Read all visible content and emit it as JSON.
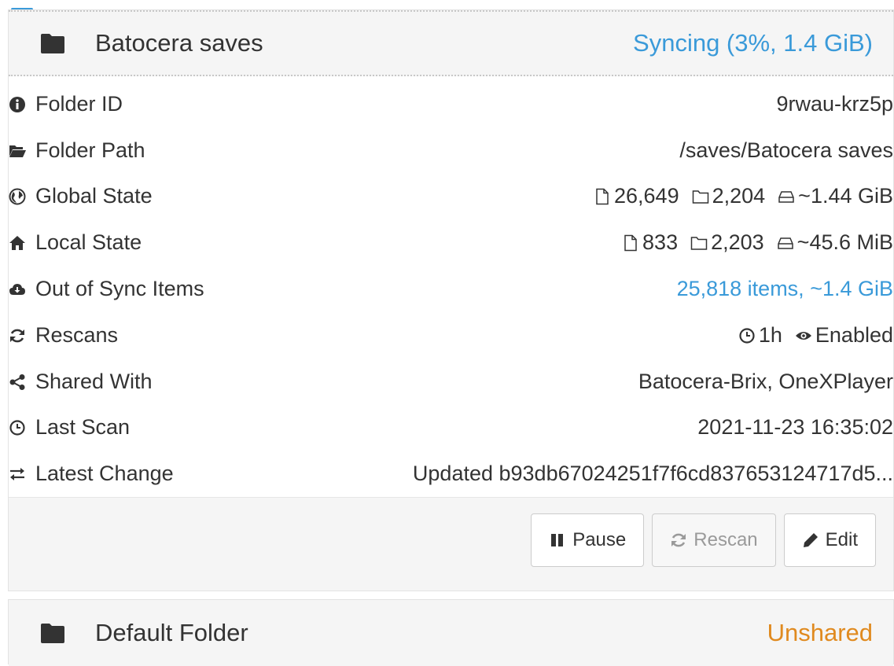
{
  "folder1": {
    "title": "Batocera saves",
    "status": "Syncing (3%, 1.4 GiB)",
    "sync_progress_percent": 3,
    "status_color": "#3a9ad9",
    "rows": {
      "folder_id": {
        "label": "Folder ID",
        "value": "9rwau-krz5p",
        "icon": "info-circle-icon"
      },
      "folder_path": {
        "label": "Folder Path",
        "value": "/saves/Batocera saves",
        "icon": "folder-open-icon"
      },
      "global_state": {
        "label": "Global State",
        "files": "26,649",
        "dirs": "2,204",
        "size": "~1.44 GiB",
        "icon": "globe-icon"
      },
      "local_state": {
        "label": "Local State",
        "files": "833",
        "dirs": "2,203",
        "size": "~45.6 MiB",
        "icon": "home-icon"
      },
      "out_of_sync": {
        "label": "Out of Sync Items",
        "value": "25,818 items, ~1.4 GiB",
        "icon": "cloud-download-icon"
      },
      "rescans": {
        "label": "Rescans",
        "interval": "1h",
        "watcher": "Enabled",
        "icon": "refresh-icon"
      },
      "shared_with": {
        "label": "Shared With",
        "value": "Batocera-Brix, OneXPlayer",
        "icon": "share-icon"
      },
      "last_scan": {
        "label": "Last Scan",
        "value": "2021-11-23 16:35:02",
        "icon": "clock-icon"
      },
      "latest_change": {
        "label": "Latest Change",
        "value": "Updated b93db67024251f7f6cd837653124717d5...",
        "icon": "exchange-icon"
      }
    },
    "buttons": {
      "pause": "Pause",
      "rescan": "Rescan",
      "edit": "Edit"
    }
  },
  "folder2": {
    "title": "Default Folder",
    "status": "Unshared",
    "status_color": "#e08a1f"
  }
}
